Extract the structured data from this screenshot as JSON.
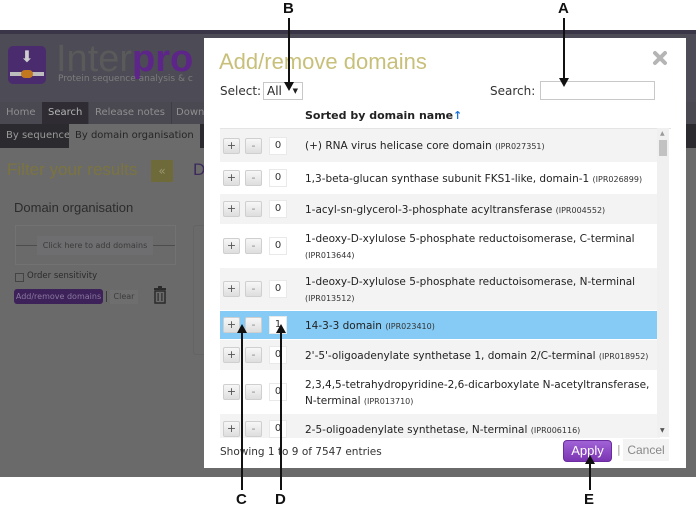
{
  "annotations": {
    "A": "A",
    "B": "B",
    "C": "C",
    "D": "D",
    "E": "E"
  },
  "background_app": {
    "logo_text_inter": "Inter",
    "logo_text_pro": "pro",
    "logo_subtitle": "Protein sequence analysis & c",
    "nav": [
      "Home",
      "Search",
      "Release notes",
      "Down"
    ],
    "nav_active": "Search",
    "subnav": [
      "By sequence",
      "By domain organisation"
    ],
    "subnav_active": "By domain organisation",
    "filter_title": "Filter your results",
    "collapse_icon": "«",
    "domain_title_fragment": "D",
    "domain_organisation_title": "Domain organisation",
    "add_domains_placeholder": "Click here to add domains",
    "order_sensitivity_label": "Order sensitivity",
    "add_remove_button": "Add/remove domains",
    "clear_button": "Clear"
  },
  "modal": {
    "title": "Add/remove domains",
    "select_label": "Select:",
    "select_value": "All",
    "search_label": "Search:",
    "search_value": "",
    "sort_header": "Sorted by domain name",
    "sort_icon": "↑",
    "close_icon": "✖",
    "rows": [
      {
        "name": "(+) RNA virus helicase core domain",
        "ipr": "(IPR027351)",
        "count": "0",
        "selected": false
      },
      {
        "name": "1,3-beta-glucan synthase subunit FKS1-like, domain-1",
        "ipr": "(IPR026899)",
        "count": "0",
        "selected": false
      },
      {
        "name": "1-acyl-sn-glycerol-3-phosphate acyltransferase",
        "ipr": "(IPR004552)",
        "count": "0",
        "selected": false
      },
      {
        "name": "1-deoxy-D-xylulose 5-phosphate reductoisomerase, C-terminal",
        "ipr": "(IPR013644)",
        "count": "0",
        "selected": false
      },
      {
        "name": "1-deoxy-D-xylulose 5-phosphate reductoisomerase, N-terminal",
        "ipr": "(IPR013512)",
        "count": "0",
        "selected": false
      },
      {
        "name": "14-3-3 domain",
        "ipr": "(IPR023410)",
        "count": "1",
        "selected": true
      },
      {
        "name": "2'-5'-oligoadenylate synthetase 1, domain 2/C-terminal",
        "ipr": "(IPR018952)",
        "count": "0",
        "selected": false
      },
      {
        "name": "2,3,4,5-tetrahydropyridine-2,6-dicarboxylate N-acetyltransferase, N-terminal",
        "ipr": "(IPR013710)",
        "count": "0",
        "selected": false
      },
      {
        "name": "2-5-oligoadenylate synthetase, N-terminal",
        "ipr": "(IPR006116)",
        "count": "0",
        "selected": false
      }
    ],
    "plus_label": "+",
    "minus_label": "-",
    "showing_text": "Showing 1 to 9 of 7547 entries",
    "apply_button": "Apply",
    "separator": "|",
    "cancel_button": "Cancel"
  },
  "colors": {
    "modal_title": "#c8c07a",
    "apply_button": "#8e4ac6",
    "selected_row": "#85cbf5",
    "sort_arrow": "#1a73d6"
  }
}
